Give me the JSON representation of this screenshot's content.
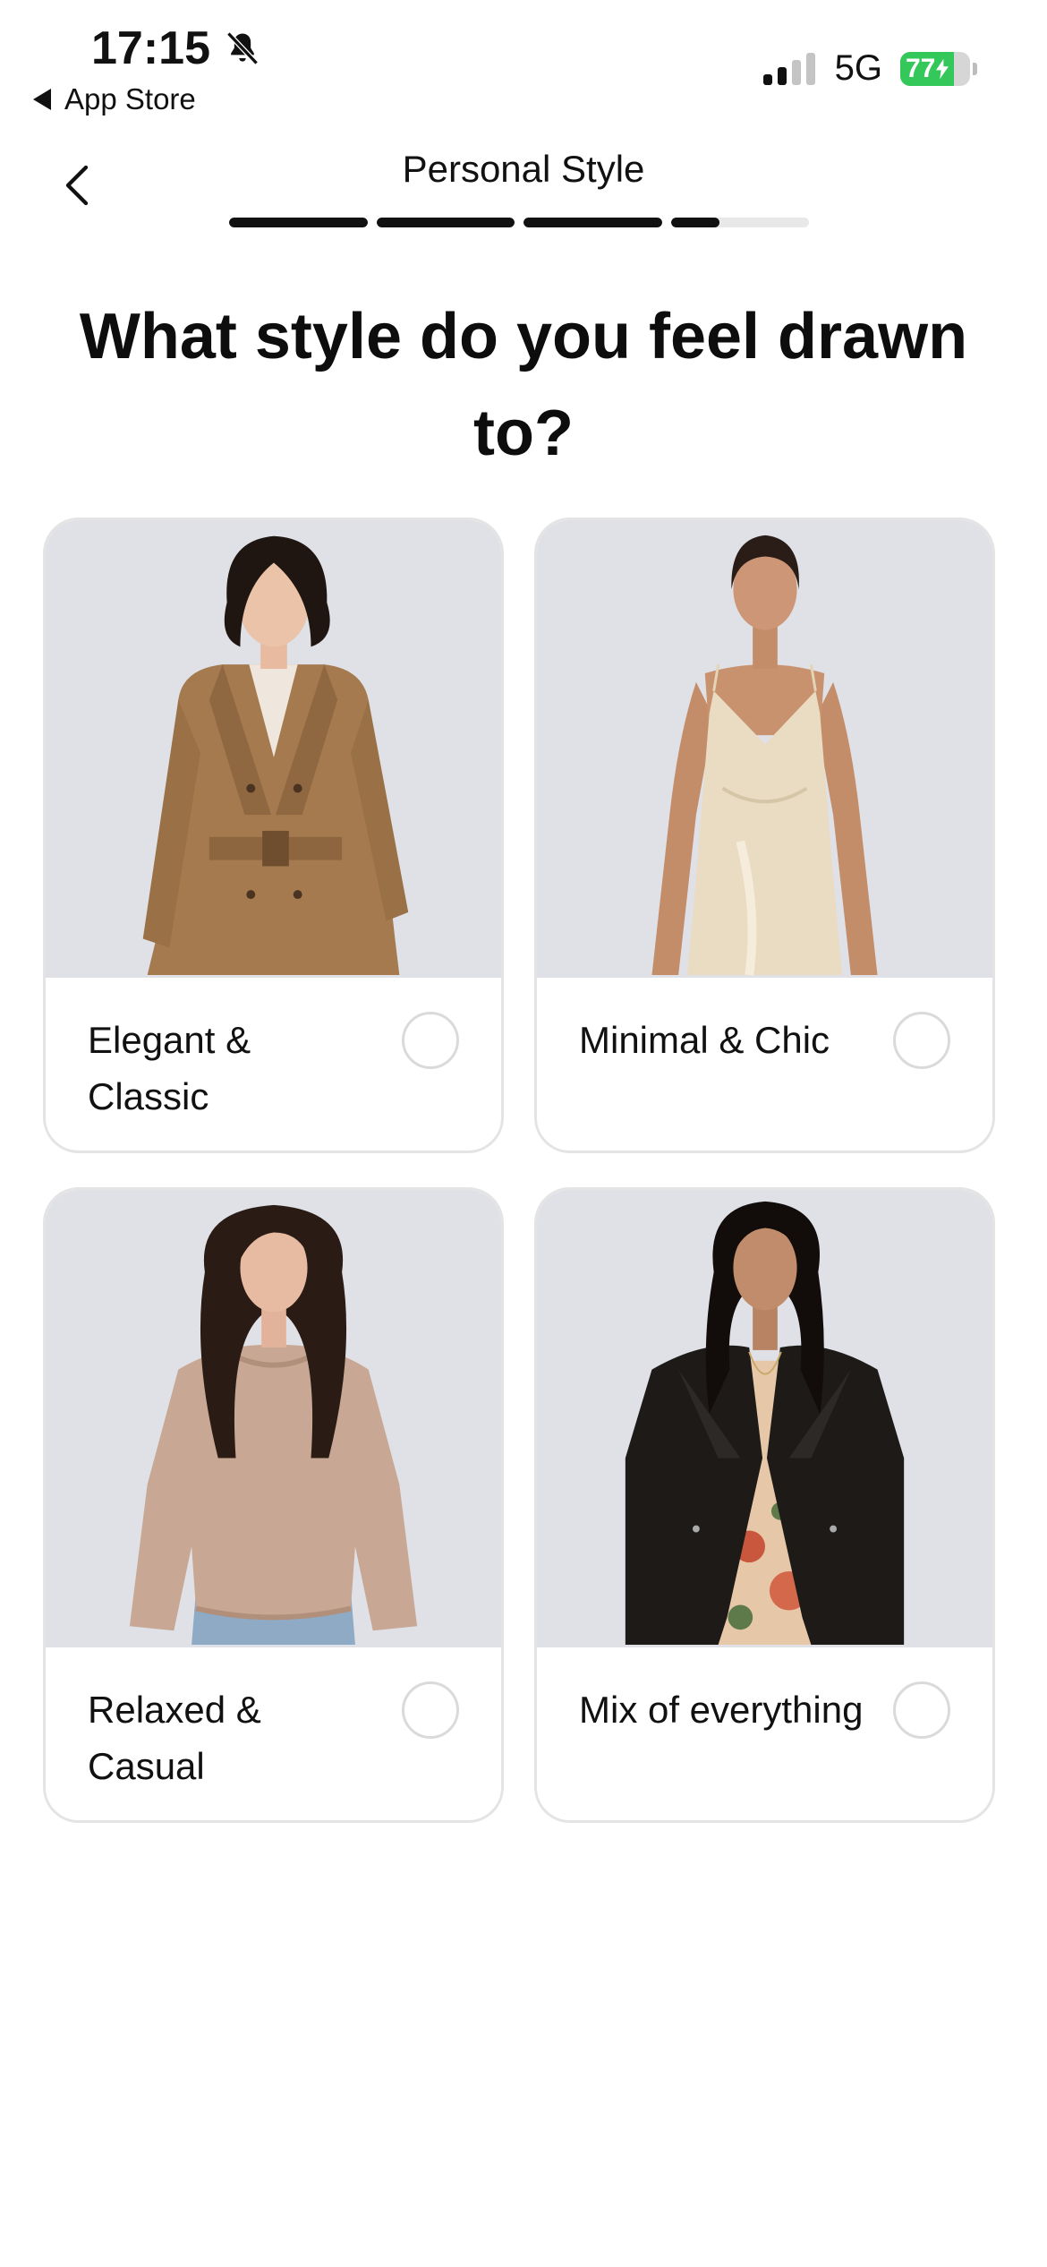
{
  "status_bar": {
    "time": "17:15",
    "back_app_label": "App Store",
    "network": "5G",
    "battery_percent": "77",
    "battery_level": 0.77,
    "icons": [
      "bell-slash-icon",
      "signal-icon",
      "battery-icon"
    ]
  },
  "header": {
    "title": "Personal Style",
    "progress": {
      "segments": 4,
      "segment_fill": [
        1,
        1,
        1,
        0.35
      ]
    }
  },
  "question": "What style do you feel drawn to?",
  "options": [
    {
      "label": "Elegant & Classic",
      "selected": false,
      "image": "woman-in-camel-trench-coat"
    },
    {
      "label": "Minimal & Chic",
      "selected": false,
      "image": "woman-in-satin-slip-dress"
    },
    {
      "label": "Relaxed & Casual",
      "selected": false,
      "image": "woman-in-knit-sweater-and-jeans"
    },
    {
      "label": "Mix of everything",
      "selected": false,
      "image": "woman-in-leather-jacket-and-floral-dress"
    }
  ],
  "colors": {
    "accent": "#111111",
    "card_image_bg": "#dfe1e6",
    "card_border": "#e4e4e4",
    "battery_green": "#34c759",
    "progress_track": "#e8e8e8"
  }
}
